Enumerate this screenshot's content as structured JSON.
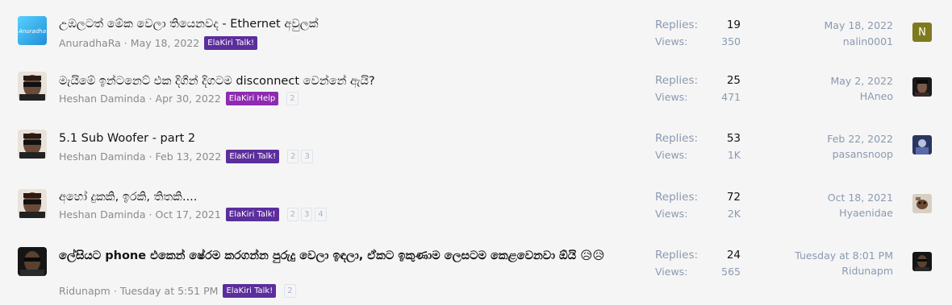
{
  "threads": [
    {
      "title": "උඹලටත් මේක වෙලා තියෙනවද - Ethernet අවුලක්",
      "author": "AnuradhaRa",
      "date": "May 18, 2022",
      "prefix": "ElaKiri Talk!",
      "prefix_color": "#5b2e9c",
      "pages": [],
      "replies_label": "Replies:",
      "replies": "19",
      "views_label": "Views:",
      "views": "350",
      "last_date": "May 18, 2022",
      "last_user": "nalin0001",
      "avatar_text": "Anuradha",
      "last_avatar_letter": "N",
      "last_avatar_color": "#7f7a1e"
    },
    {
      "title": "මැයිමේ ඉන්ටනෙට් එක දිගින් දිගටම disconnect වෙන්නේ ඇයි?",
      "author": "Heshan Daminda",
      "date": "Apr 30, 2022",
      "prefix": "ElaKiri Help",
      "prefix_color": "#8e2bb0",
      "pages": [
        "2"
      ],
      "replies_label": "Replies:",
      "replies": "25",
      "views_label": "Views:",
      "views": "471",
      "last_date": "May 2, 2022",
      "last_user": "HAneo"
    },
    {
      "title": "5.1 Sub Woofer - part 2",
      "author": "Heshan Daminda",
      "date": "Feb 13, 2022",
      "prefix": "ElaKiri Talk!",
      "prefix_color": "#5b2e9c",
      "pages": [
        "2",
        "3"
      ],
      "replies_label": "Replies:",
      "replies": "53",
      "views_label": "Views:",
      "views": "1K",
      "last_date": "Feb 22, 2022",
      "last_user": "pasansnoop"
    },
    {
      "title": "අහෝ දුකකි, ඉරකි, තිතකි....",
      "author": "Heshan Daminda",
      "date": "Oct 17, 2021",
      "prefix": "ElaKiri Talk!",
      "prefix_color": "#5b2e9c",
      "pages": [
        "2",
        "3",
        "4"
      ],
      "replies_label": "Replies:",
      "replies": "72",
      "views_label": "Views:",
      "views": "2K",
      "last_date": "Oct 18, 2021",
      "last_user": "Hyaenidae"
    },
    {
      "title": "ලේසියට phone එකෙන් ෂේරම කරගන්න පුරුදු වෙලා ඉඳලා, ඒකට ඉකුණාම ලෙසටම කෙළවෙනවා ඕයි 😥😥",
      "author": "Ridunapm",
      "date": "Tuesday at 5:51 PM",
      "prefix": "ElaKiri Talk!",
      "prefix_color": "#5b2e9c",
      "pages": [
        "2"
      ],
      "replies_label": "Replies:",
      "replies": "24",
      "views_label": "Views:",
      "views": "565",
      "last_date": "Tuesday at 8:01 PM",
      "last_user": "Ridunapm"
    }
  ],
  "colors": {
    "background": "#f5f5f5",
    "muted": "#8a9ab0",
    "text": "#141414",
    "talk_prefix": "#5b2e9c",
    "help_prefix": "#8e2bb0"
  }
}
